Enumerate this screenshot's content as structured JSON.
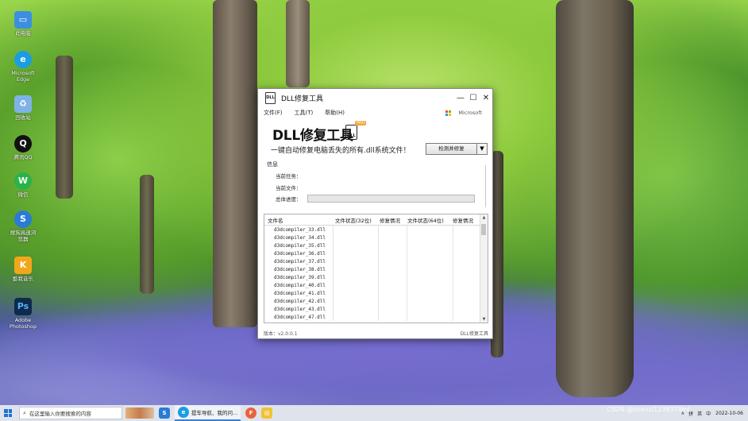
{
  "desktop": {
    "icons": [
      {
        "label": "此电脑",
        "icon": "computer-icon",
        "color": "#3b8fe0"
      },
      {
        "label": "Microsoft Edge",
        "icon": "edge-icon",
        "color": "#1b9de2"
      },
      {
        "label": "回收站",
        "icon": "recycle-bin-icon",
        "color": "#7fb2e6"
      },
      {
        "label": "腾讯QQ",
        "icon": "qq-icon",
        "color": "#111111"
      },
      {
        "label": "微信",
        "icon": "wechat-icon",
        "color": "#29b34a"
      },
      {
        "label": "搜狗高速浏览器",
        "icon": "sogou-browser-icon",
        "color": "#2a7ad6"
      },
      {
        "label": "酷我音乐",
        "icon": "kuwo-music-icon",
        "color": "#f2a71b"
      },
      {
        "label": "Adobe Photoshop",
        "icon": "photoshop-icon",
        "color": "#0f2a4a"
      }
    ]
  },
  "window": {
    "title": "DLL修复工具",
    "controls": {
      "minimize": "—",
      "maximize": "☐",
      "close": "✕"
    },
    "menu": [
      "文件(F)",
      "工具(T)",
      "帮助(H)"
    ],
    "brand": "Microsoft",
    "heading": "DLL修复工具",
    "badge_text": "DLL",
    "pro_label": "PRO",
    "subtitle": "一键自动修复电脑丢失的所有.dll系统文件！",
    "scan_button": "检测并修复",
    "dropdown_arrow": "▼",
    "info": {
      "section_label": "信息",
      "task_label": "当前任务：",
      "file_label": "当前文件：",
      "progress_label": "总体进度：",
      "progress_value": 0
    },
    "table": {
      "columns": [
        "文件名",
        "文件状态(32位)",
        "修复情况",
        "文件状态(64位)",
        "修复情况"
      ],
      "rows": [
        "d3dcompiler_33.dll",
        "d3dcompiler_34.dll",
        "d3dcompiler_35.dll",
        "d3dcompiler_36.dll",
        "d3dcompiler_37.dll",
        "d3dcompiler_38.dll",
        "d3dcompiler_39.dll",
        "d3dcompiler_40.dll",
        "d3dcompiler_41.dll",
        "d3dcompiler_42.dll",
        "d3dcompiler_43.dll",
        "d3dcompiler_47.dll"
      ]
    },
    "status": {
      "version": "版本：v2.0.0.1",
      "name": "DLL修复工具"
    }
  },
  "taskbar": {
    "search_placeholder": "在这里输入你要搜索的内容",
    "task_label": "提车导航、我的问...",
    "tray": [
      "∧",
      "拼",
      "英",
      "中"
    ],
    "time": "",
    "date": "2022-10-06"
  },
  "watermark": "CSDN @shenzi1238378ml"
}
